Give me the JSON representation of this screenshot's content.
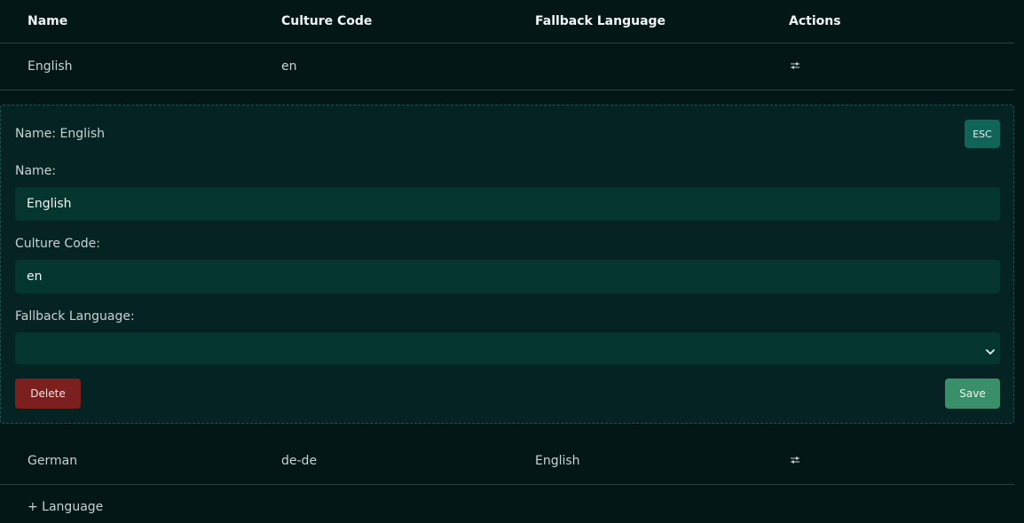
{
  "table": {
    "headers": {
      "name": "Name",
      "culture_code": "Culture Code",
      "fallback_language": "Fallback Language",
      "actions": "Actions"
    },
    "rows": [
      {
        "name": "English",
        "culture_code": "en",
        "fallback_language": "",
        "action_icon": "filter-icon"
      },
      {
        "name": "German",
        "culture_code": "de-de",
        "fallback_language": "English",
        "action_icon": "filter-icon"
      }
    ]
  },
  "editor": {
    "title": "Name: English",
    "esc_label": "ESC",
    "name_label": "Name:",
    "name_value": "English",
    "culture_code_label": "Culture Code:",
    "culture_code_value": "en",
    "fallback_label": "Fallback Language:",
    "fallback_value": "",
    "delete_label": "Delete",
    "save_label": "Save"
  },
  "add_language_label": "+ Language",
  "colors": {
    "background": "#031717",
    "editor_background": "#042322",
    "input_background": "#04352f",
    "esc_button": "#106458",
    "delete_button": "#7c1f1f",
    "save_button": "#3a8f6b"
  }
}
